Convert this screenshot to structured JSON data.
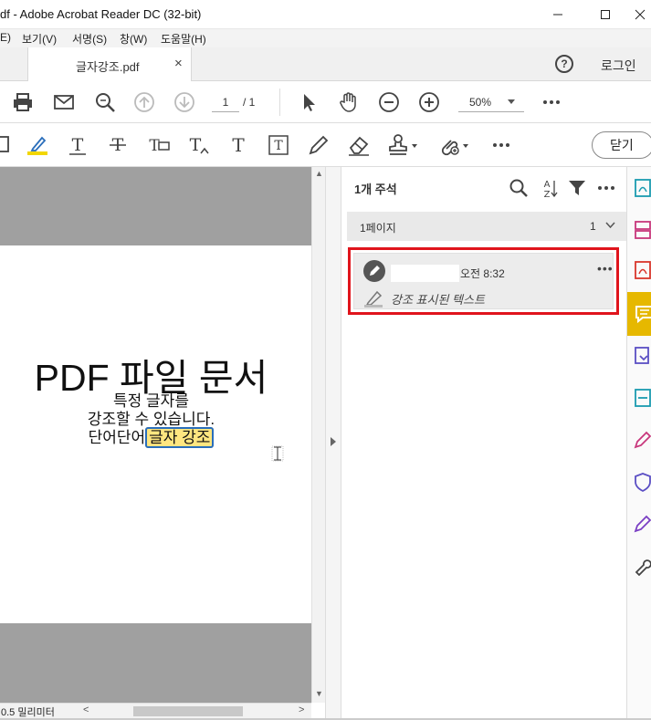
{
  "window": {
    "title": "df - Adobe Acrobat Reader DC (32-bit)"
  },
  "menu": [
    "E)",
    "보기(V)",
    "서명(S)",
    "창(W)",
    "도움말(H)"
  ],
  "tab": {
    "label": "글자강조.pdf",
    "close": "×"
  },
  "header": {
    "help": "?",
    "login": "로그인"
  },
  "toolbar": {
    "page_current": "1",
    "page_total": "/ 1",
    "zoom": "50%"
  },
  "toolbar2": {
    "close_label": "닫기"
  },
  "document": {
    "title": "PDF 파일 문서",
    "line1": "특정 글자를",
    "line2": "강조할 수 있습니다.",
    "line3_prefix": "단어단어",
    "line3_highlight": "글자 강조"
  },
  "scrollbar": {
    "dimension": "0.5 밀리미터"
  },
  "comments": {
    "title": "1개 주석",
    "group_label": "1페이지",
    "group_count": "1",
    "item": {
      "time": "오전 8:32",
      "text": "강조 표시된 텍스트"
    }
  },
  "colors": {
    "highlight": "#ffe680",
    "selection_border": "#e0141c",
    "rail_active": "#e6b800"
  }
}
